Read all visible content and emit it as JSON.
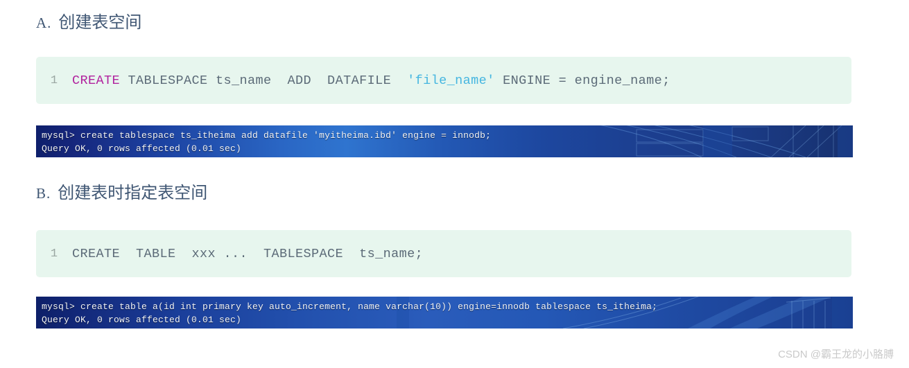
{
  "sections": [
    {
      "marker": "A.",
      "title": "创建表空间",
      "code": {
        "line_number": "1",
        "tokens": [
          {
            "text": "CREATE",
            "type": "keyword"
          },
          {
            "text": " TABLESPACE ts_name  ADD  DATAFILE  ",
            "type": "plain"
          },
          {
            "text": "'file_name'",
            "type": "string"
          },
          {
            "text": " ENGINE = engine_name;",
            "type": "plain"
          }
        ],
        "plain_text": "CREATE TABLESPACE ts_name  ADD  DATAFILE  'file_name' ENGINE = engine_name;"
      },
      "terminal": {
        "command_line": "mysql> create tablespace ts_itheima add datafile 'myitheima.ibd' engine = innodb;",
        "result_line": "Query OK, 0 rows affected (0.01 sec)"
      }
    },
    {
      "marker": "B.",
      "title": "创建表时指定表空间",
      "code": {
        "line_number": "1",
        "tokens": [
          {
            "text": "CREATE  TABLE  xxx ...  TABLESPACE  ts_name;",
            "type": "plain"
          }
        ],
        "plain_text": "CREATE  TABLE  xxx ...  TABLESPACE  ts_name;"
      },
      "terminal": {
        "command_line": "mysql> create table a(id int primary key auto_increment, name varchar(10)) engine=innodb tablespace ts_itheima;",
        "result_line": "Query OK, 0 rows affected (0.01 sec)"
      }
    }
  ],
  "watermark": "CSDN @霸王龙的小胳膊",
  "colors": {
    "heading": "#3f5673",
    "code_background": "#e7f6ee",
    "code_text": "#5c6b78",
    "keyword": "#b1229e",
    "string": "#45b6e0",
    "terminal_text": "#f2f4f8",
    "watermark": "#c9c9c9"
  }
}
